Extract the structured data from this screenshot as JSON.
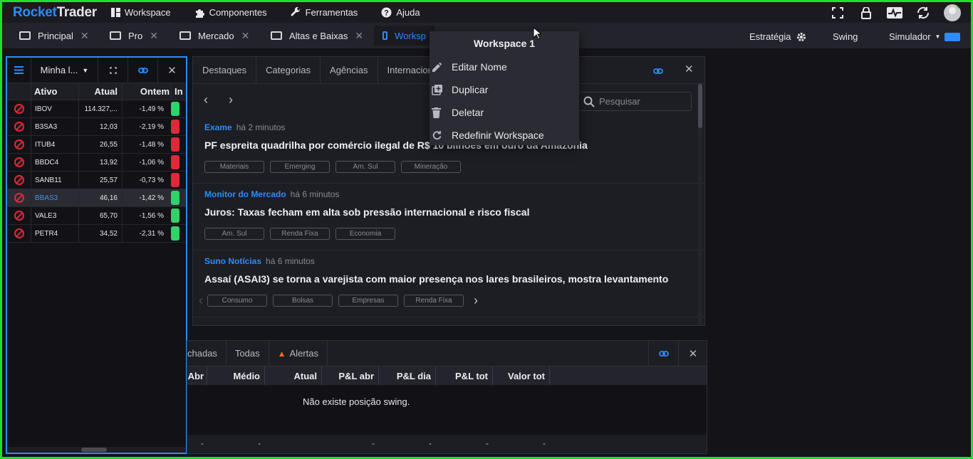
{
  "app": {
    "logo_part1": "Rocket",
    "logo_part2": "Trader"
  },
  "menu": [
    {
      "label": "Workspace",
      "icon": "grid-icon"
    },
    {
      "label": "Componentes",
      "icon": "puzzle-icon"
    },
    {
      "label": "Ferramentas",
      "icon": "wrench-icon"
    },
    {
      "label": "Ajuda",
      "icon": "help-icon"
    }
  ],
  "workspace_tabs": [
    {
      "label": "Principal"
    },
    {
      "label": "Pro"
    },
    {
      "label": "Mercado"
    },
    {
      "label": "Altas e Baixas"
    },
    {
      "label": "Worksp"
    }
  ],
  "topright": {
    "strategy": "Estratégia",
    "swing": "Swing",
    "simulator": "Simulador"
  },
  "watchlist": {
    "name": "Minha l...",
    "columns": [
      "Ativo",
      "Atual",
      "Ontem",
      "In"
    ],
    "rows": [
      {
        "symbol": "IBOV",
        "atual": "114.327,...",
        "ontem": "-1,49 %",
        "ind": "#2ed36a"
      },
      {
        "symbol": "B3SA3",
        "atual": "12,03",
        "ontem": "-2,19 %",
        "ind": "#e0283a"
      },
      {
        "symbol": "ITUB4",
        "atual": "26,55",
        "ontem": "-1,48 %",
        "ind": "#e0283a"
      },
      {
        "symbol": "BBDC4",
        "atual": "13,92",
        "ontem": "-1,06 %",
        "ind": "#e0283a"
      },
      {
        "symbol": "SANB11",
        "atual": "25,57",
        "ontem": "-0,73 %",
        "ind": "#e0283a"
      },
      {
        "symbol": "BBAS3",
        "atual": "46,16",
        "ontem": "-1,42 %",
        "ind": "#2ed36a"
      },
      {
        "symbol": "VALE3",
        "atual": "65,70",
        "ontem": "-1,56 %",
        "ind": "#2ed36a"
      },
      {
        "symbol": "PETR4",
        "atual": "34,52",
        "ontem": "-2,31 %",
        "ind": "#2ed36a"
      }
    ]
  },
  "news": {
    "tabs": [
      "Destaques",
      "Categorias",
      "Agências",
      "Internacion"
    ],
    "search_placeholder": "Pesquisar",
    "items": [
      {
        "source": "Exame",
        "time": "há 2 minutos",
        "headline": "PF espreita quadrilha por comércio ilegal de R$ 10 bilhões em ouro da Amazônia",
        "tags": [
          "Materiais",
          "Emerging",
          "Am. Sul",
          "Mineração"
        ]
      },
      {
        "source": "Monitor do Mercado",
        "time": "há 6 minutos",
        "headline": "Juros: Taxas fecham em alta sob pressão internacional e risco fiscal",
        "tags": [
          "Am. Sul",
          "Renda Fixa",
          "Economia"
        ]
      },
      {
        "source": "Suno Notícias",
        "time": "há 6 minutos",
        "headline": "Assaí (ASAI3) se torna a varejista com maior presença nos lares brasileiros, mostra levantamento",
        "tags": [
          "Consumo",
          "Bolsas",
          "Empresas",
          "Renda Fixa"
        ]
      }
    ]
  },
  "positions": {
    "tabs": [
      "chadas",
      "Todas",
      "Alertas"
    ],
    "columns": [
      "Abr",
      "Médio",
      "Atual",
      "P&L abr",
      "P&L dia",
      "P&L tot",
      "Valor tot"
    ],
    "empty_message": "Não existe posição swing.",
    "footer_dash": "-"
  },
  "context_menu": {
    "title": "Workspace 1",
    "items": [
      {
        "label": "Editar Nome",
        "icon": "pencil-icon"
      },
      {
        "label": "Duplicar",
        "icon": "duplicate-icon"
      },
      {
        "label": "Deletar",
        "icon": "trash-icon"
      },
      {
        "label": "Redefinir Workspace",
        "icon": "reset-icon"
      }
    ]
  },
  "colors": {
    "accent": "#2c8cff",
    "up": "#2ed36a",
    "down": "#e0283a",
    "frame": "#1ee02a"
  }
}
